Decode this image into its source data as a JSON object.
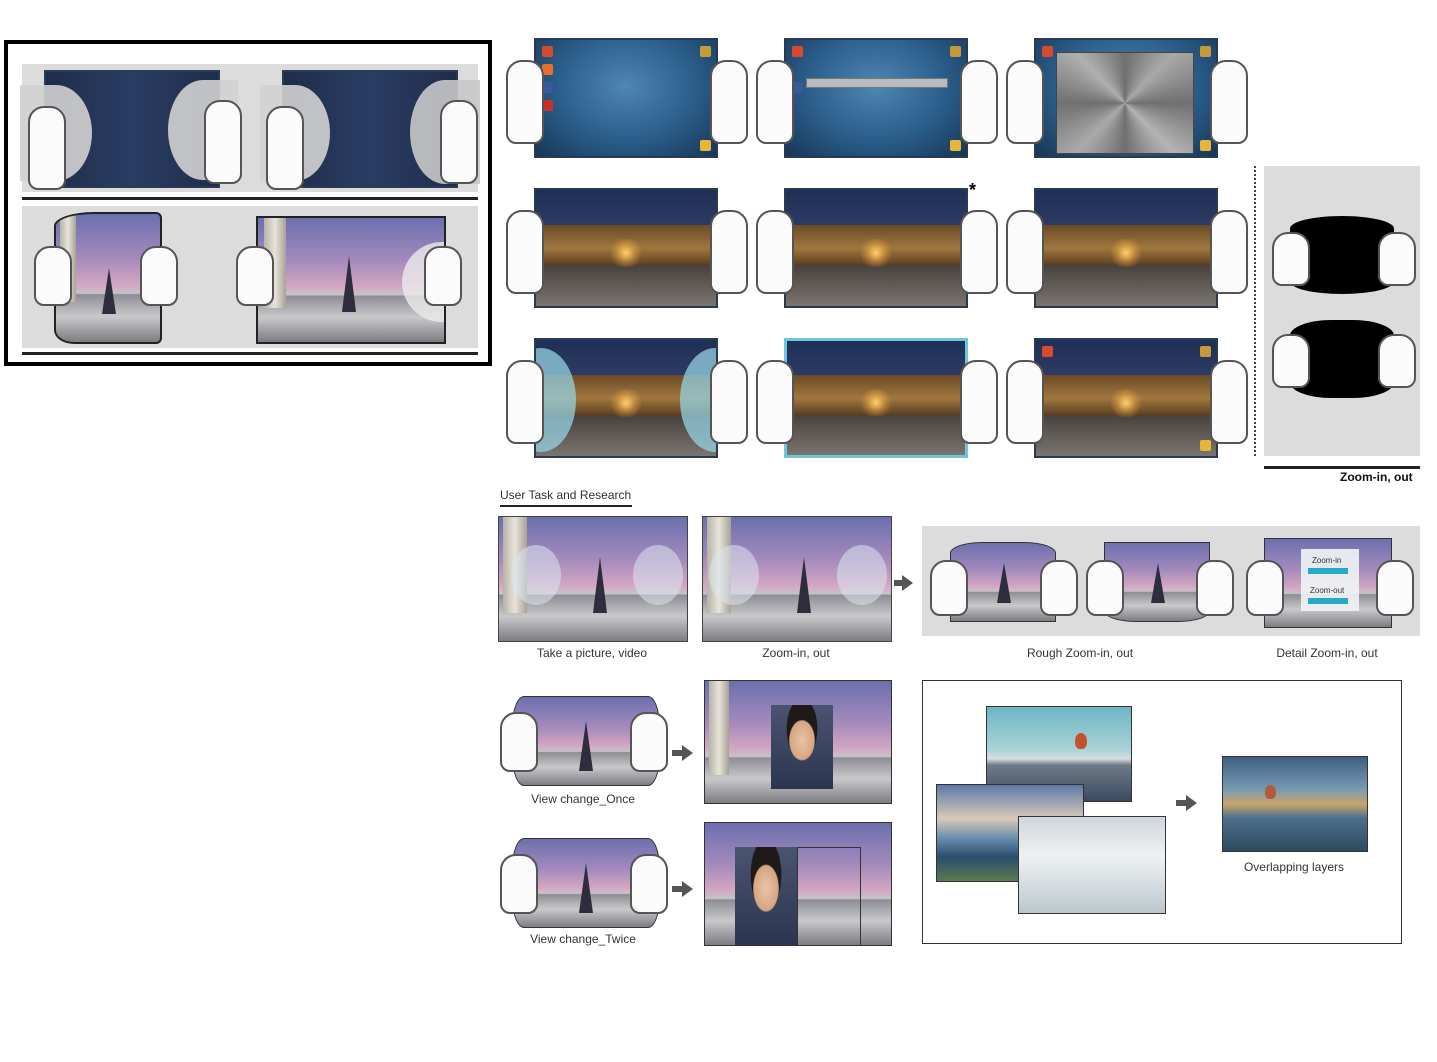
{
  "top_right_label": "Zoom-in, out",
  "section_title": "User Task and Research",
  "asterisk": "*",
  "captions": {
    "take_picture": "Take a picture, video",
    "zoom": "Zoom-in, out",
    "rough_zoom": "Rough Zoom-in, out",
    "detail_zoom": "Detail Zoom-in, out",
    "view_once": "View change_Once",
    "view_twice": "View change_Twice",
    "overlapping": "Overlapping layers"
  },
  "detail_labels": {
    "zoom_in": "Zoom-in",
    "zoom_out": "Zoom-out"
  },
  "colors": {
    "frame": "#000000",
    "tablet_blue": "#2a5d8a",
    "cyan_arrow": "#27a9c8",
    "gray_panel": "#dcdcdc"
  }
}
